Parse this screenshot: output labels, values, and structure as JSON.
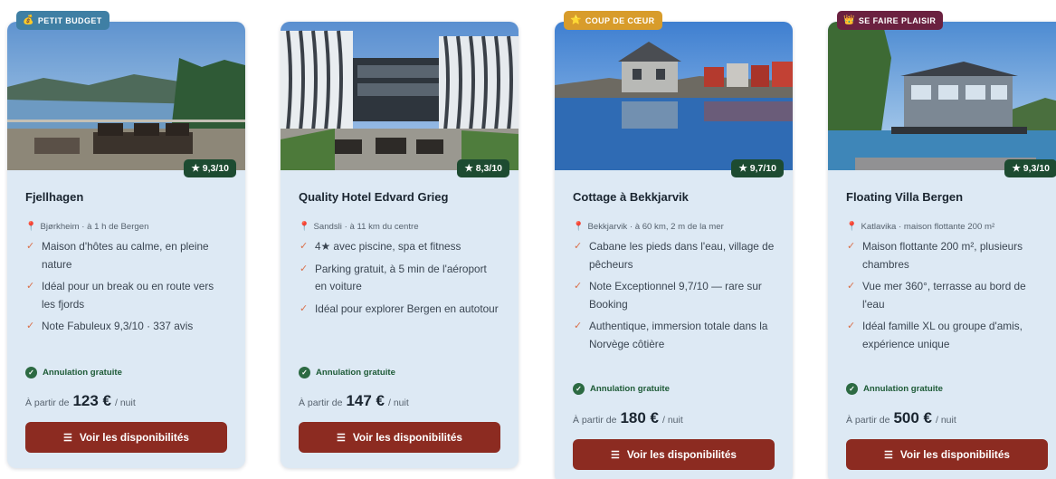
{
  "colors": {
    "card_bg": "#dde9f4",
    "cta_bg": "#8c2b21",
    "rating_bg": "#1d4b31",
    "cancel_green": "#2c6a42",
    "badge_budget": "#3f7fa4",
    "badge_favorite": "#d89c2b",
    "badge_treat": "#6b2140"
  },
  "cards": [
    {
      "badge": {
        "icon": "money-bag-icon",
        "glyph": "💰",
        "label": "PETIT BUDGET"
      },
      "rating": "★ 9,3/10",
      "title": "Fjellhagen",
      "location": "Bjørkheim · à 1 h de Bergen",
      "bullets": [
        "Maison d'hôtes au calme, en pleine nature",
        "Idéal pour un break ou en route vers les fjords",
        "Note Fabuleux 9,3/10 · 337 avis"
      ],
      "cancellation": "Annulation gratuite",
      "price_prefix": "À partir de",
      "price": "123 €",
      "price_suffix": "/ nuit",
      "cta": "Voir les disponibilités"
    },
    {
      "badge": null,
      "rating": "★ 8,3/10",
      "title": "Quality Hotel Edvard Grieg",
      "location": "Sandsli · à 11 km du centre",
      "bullets": [
        "4★ avec piscine, spa et fitness",
        "Parking gratuit, à 5 min de l'aéroport en voiture",
        "Idéal pour explorer Bergen en autotour"
      ],
      "cancellation": "Annulation gratuite",
      "price_prefix": "À partir de",
      "price": "147 €",
      "price_suffix": "/ nuit",
      "cta": "Voir les disponibilités"
    },
    {
      "badge": {
        "icon": "star-icon",
        "glyph": "⭐",
        "label": "COUP DE CŒUR"
      },
      "rating": "★ 9,7/10",
      "title": "Cottage à Bekkjarvik",
      "location": "Bekkjarvik · à 60 km, 2 m de la mer",
      "bullets": [
        "Cabane les pieds dans l'eau, village de pêcheurs",
        "Note Exceptionnel 9,7/10 — rare sur Booking",
        "Authentique, immersion totale dans la Norvège côtière"
      ],
      "cancellation": "Annulation gratuite",
      "price_prefix": "À partir de",
      "price": "180 €",
      "price_suffix": "/ nuit",
      "cta": "Voir les disponibilités"
    },
    {
      "badge": {
        "icon": "crown-icon",
        "glyph": "👑",
        "label": "SE FAIRE PLAISIR"
      },
      "rating": "★ 9,3/10",
      "title": "Floating Villa Bergen",
      "location": "Katlavika · maison flottante 200 m²",
      "bullets": [
        "Maison flottante 200 m², plusieurs chambres",
        "Vue mer 360°, terrasse au bord de l'eau",
        "Idéal famille XL ou groupe d'amis, expérience unique"
      ],
      "cancellation": "Annulation gratuite",
      "price_prefix": "À partir de",
      "price": "500 €",
      "price_suffix": "/ nuit",
      "cta": "Voir les disponibilités"
    }
  ]
}
